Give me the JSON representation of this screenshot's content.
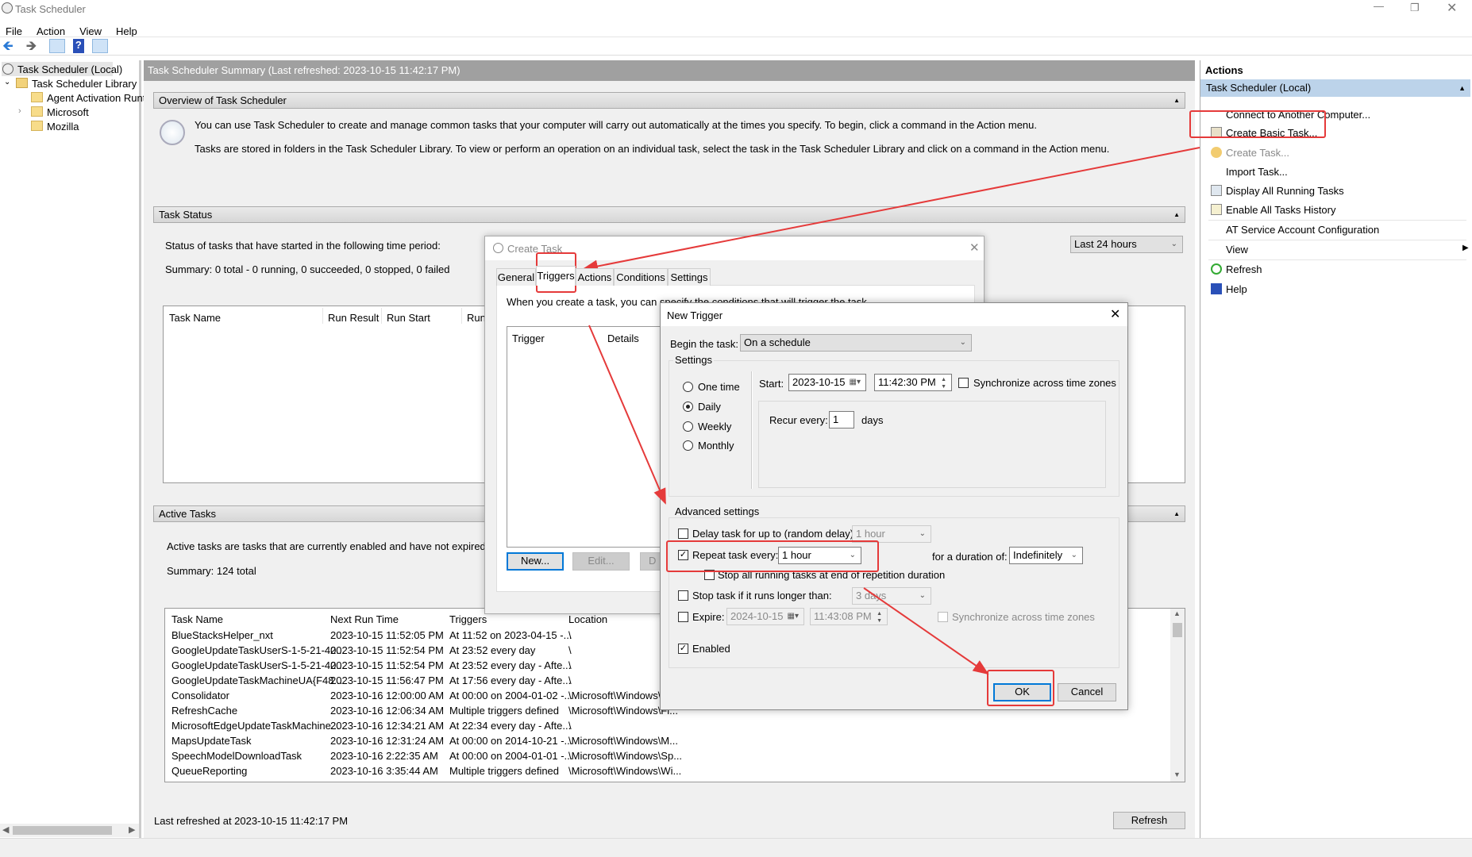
{
  "window": {
    "title": "Task Scheduler",
    "controls": [
      "minimize",
      "restore",
      "close"
    ]
  },
  "menu": [
    "File",
    "Action",
    "View",
    "Help"
  ],
  "toolbar": {
    "icons": [
      "back-icon",
      "forward-icon",
      "show-hide-console-tree-icon",
      "help-icon",
      "show-hide-action-pane-icon"
    ]
  },
  "tree": {
    "root": "Task Scheduler (Local)",
    "library": "Task Scheduler Library",
    "folders": [
      "Agent Activation Runt",
      "Microsoft",
      "Mozilla"
    ]
  },
  "center": {
    "header": "Task Scheduler Summary (Last refreshed: 2023-10-15 11:42:17 PM)",
    "overview": {
      "title": "Overview of Task Scheduler",
      "line1": "You can use Task Scheduler to create and manage common tasks that your computer will carry out automatically at the times you specify. To begin, click a command in the Action menu.",
      "line2": "Tasks are stored in folders in the Task Scheduler Library. To view or perform an operation on an individual task, select the task in the Task Scheduler Library and click on a command in the Action menu."
    },
    "status": {
      "title": "Task Status",
      "desc": "Status of tasks that have started in the following time period:",
      "summary": "Summary: 0 total - 0 running, 0 succeeded, 0 stopped, 0 failed",
      "period": "Last 24 hours",
      "columns": [
        "Task Name",
        "Run Result",
        "Run Start",
        "Run"
      ]
    },
    "active": {
      "title": "Active Tasks",
      "desc": "Active tasks are tasks that are currently enabled and have not expired.",
      "summary": "Summary: 124 total",
      "columns": [
        "Task Name",
        "Next Run Time",
        "Triggers",
        "Location"
      ],
      "rows": [
        [
          "BlueStacksHelper_nxt",
          "2023-10-15 11:52:05 PM",
          "At 11:52 on 2023-04-15 -...",
          "\\"
        ],
        [
          "GoogleUpdateTaskUserS-1-5-21-40...",
          "2023-10-15 11:52:54 PM",
          "At 23:52 every day",
          "\\"
        ],
        [
          "GoogleUpdateTaskUserS-1-5-21-40...",
          "2023-10-15 11:52:54 PM",
          "At 23:52 every day - Afte...",
          "\\"
        ],
        [
          "GoogleUpdateTaskMachineUA{F48...",
          "2023-10-15 11:56:47 PM",
          "At 17:56 every day - Afte...",
          "\\"
        ],
        [
          "Consolidator",
          "2023-10-16 12:00:00 AM",
          "At 00:00 on 2004-01-02 -...",
          "\\Microsoft\\Windows\\"
        ],
        [
          "RefreshCache",
          "2023-10-16 12:06:34 AM",
          "Multiple triggers defined",
          "\\Microsoft\\Windows\\Fl..."
        ],
        [
          "MicrosoftEdgeUpdateTaskMachine...",
          "2023-10-16 12:34:21 AM",
          "At 22:34 every day - Afte...",
          "\\"
        ],
        [
          "MapsUpdateTask",
          "2023-10-16 12:31:24 AM",
          "At 00:00 on 2014-10-21 -...",
          "\\Microsoft\\Windows\\M..."
        ],
        [
          "SpeechModelDownloadTask",
          "2023-10-16 2:22:35 AM",
          "At 00:00 on 2004-01-01 -...",
          "\\Microsoft\\Windows\\Sp..."
        ],
        [
          "QueueReporting",
          "2023-10-16 3:35:44 AM",
          "Multiple triggers defined",
          "\\Microsoft\\Windows\\Wi..."
        ]
      ]
    },
    "footer": {
      "last_refreshed": "Last refreshed at 2023-10-15 11:42:17 PM",
      "refresh": "Refresh"
    }
  },
  "actions": {
    "title": "Actions",
    "section": "Task Scheduler (Local)",
    "items": [
      {
        "label": "Connect to Another Computer...",
        "icon": ""
      },
      {
        "label": "Create Basic Task...",
        "icon": "create-basic-task-icon"
      },
      {
        "label": "Create Task...",
        "icon": "create-task-icon"
      },
      {
        "label": "Import Task...",
        "icon": ""
      },
      {
        "label": "Display All Running Tasks",
        "icon": "running-tasks-icon"
      },
      {
        "label": "Enable All Tasks History",
        "icon": "history-icon"
      },
      {
        "label": "AT Service Account Configuration",
        "icon": ""
      },
      {
        "label": "View",
        "icon": ""
      },
      {
        "label": "Refresh",
        "icon": "refresh-icon"
      },
      {
        "label": "Help",
        "icon": "help-icon"
      }
    ]
  },
  "create_task": {
    "title": "Create Task",
    "tabs": [
      "General",
      "Triggers",
      "Actions",
      "Conditions",
      "Settings"
    ],
    "active_tab": "Triggers",
    "desc": "When you create a task, you can specify the conditions that will trigger the task.",
    "columns": [
      "Trigger",
      "Details"
    ],
    "buttons": [
      "New...",
      "Edit...",
      "D"
    ]
  },
  "new_trigger": {
    "title": "New Trigger",
    "begin_label": "Begin the task:",
    "begin_value": "On a schedule",
    "settings_label": "Settings",
    "schedule_options": [
      "One time",
      "Daily",
      "Weekly",
      "Monthly"
    ],
    "selected_schedule": "Daily",
    "start_label": "Start:",
    "start_date": "2023-10-15",
    "start_time": "11:42:30 PM",
    "sync_label": "Synchronize across time zones",
    "sync_checked": false,
    "recur_label": "Recur every:",
    "recur_value": "1",
    "recur_unit": "days",
    "advanced_label": "Advanced settings",
    "delay_label": "Delay task for up to (random delay):",
    "delay_checked": false,
    "delay_value": "1 hour",
    "repeat_label": "Repeat task every:",
    "repeat_checked": true,
    "repeat_value": "1 hour",
    "duration_label": "for a duration of:",
    "duration_value": "Indefinitely",
    "stop_all_label": "Stop all running tasks at end of repetition duration",
    "stop_all_checked": false,
    "stop_if_label": "Stop task if it runs longer than:",
    "stop_if_checked": false,
    "stop_if_value": "3 days",
    "expire_label": "Expire:",
    "expire_checked": false,
    "expire_date": "2024-10-15",
    "expire_time": "11:43:08 PM",
    "expire_sync_label": "Synchronize across time zones",
    "enabled_label": "Enabled",
    "enabled_checked": true,
    "ok": "OK",
    "cancel": "Cancel"
  },
  "annotations": {
    "color": "#e53a3a"
  },
  "colors": {
    "accent": "#0078d7",
    "section_blue": "#bcd3ea",
    "header_gray": "#a0a0a0"
  }
}
